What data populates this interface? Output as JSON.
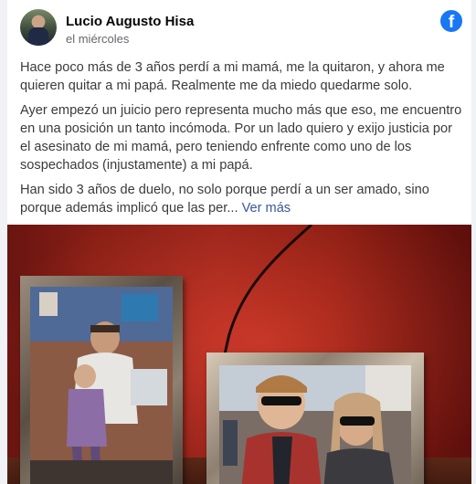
{
  "post": {
    "author": "Lucio Augusto Hisa",
    "time": "el miércoles",
    "paragraphs": [
      "Hace poco más de 3 años perdí a mi mamá, me la quitaron, y ahora me quieren quitar a mi papá. Realmente me da miedo quedarme solo.",
      "Ayer empezó un juicio pero representa mucho más que eso, me encuentro en una posición un tanto incómoda. Por un lado quiero y exijo justicia por el asesinato de mi mamá, pero teniendo enfrente como uno de los sospechados (injustamente) a mi papá.",
      "Han sido 3 años de duelo, no solo porque perdí a un ser amado, sino porque además implicó que las per..."
    ],
    "see_more": "Ver más"
  },
  "icons": {
    "platform": "facebook-icon",
    "platform_glyph": "f",
    "platform_color": "#1877f2"
  }
}
